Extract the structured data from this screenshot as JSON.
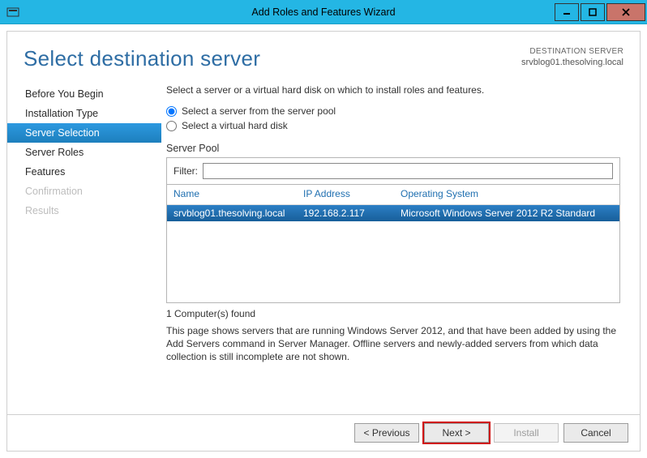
{
  "window": {
    "title": "Add Roles and Features Wizard"
  },
  "header": {
    "page_title": "Select destination server",
    "dest_label": "DESTINATION SERVER",
    "dest_name": "srvblog01.thesolving.local"
  },
  "nav": {
    "items": [
      {
        "label": "Before You Begin",
        "state": "normal"
      },
      {
        "label": "Installation Type",
        "state": "normal"
      },
      {
        "label": "Server Selection",
        "state": "active"
      },
      {
        "label": "Server Roles",
        "state": "normal"
      },
      {
        "label": "Features",
        "state": "normal"
      },
      {
        "label": "Confirmation",
        "state": "disabled"
      },
      {
        "label": "Results",
        "state": "disabled"
      }
    ]
  },
  "content": {
    "intro": "Select a server or a virtual hard disk on which to install roles and features.",
    "radio1": "Select a server from the server pool",
    "radio2": "Select a virtual hard disk",
    "section_label": "Server Pool",
    "filter_label": "Filter:",
    "filter_value": "",
    "columns": {
      "name": "Name",
      "ip": "IP Address",
      "os": "Operating System"
    },
    "rows": [
      {
        "name": "srvblog01.thesolving.local",
        "ip": "192.168.2.117",
        "os": "Microsoft Windows Server 2012 R2 Standard"
      }
    ],
    "found": "1 Computer(s) found",
    "help": "This page shows servers that are running Windows Server 2012, and that have been added by using the Add Servers command in Server Manager. Offline servers and newly-added servers from which data collection is still incomplete are not shown."
  },
  "buttons": {
    "previous": "< Previous",
    "next": "Next >",
    "install": "Install",
    "cancel": "Cancel"
  }
}
